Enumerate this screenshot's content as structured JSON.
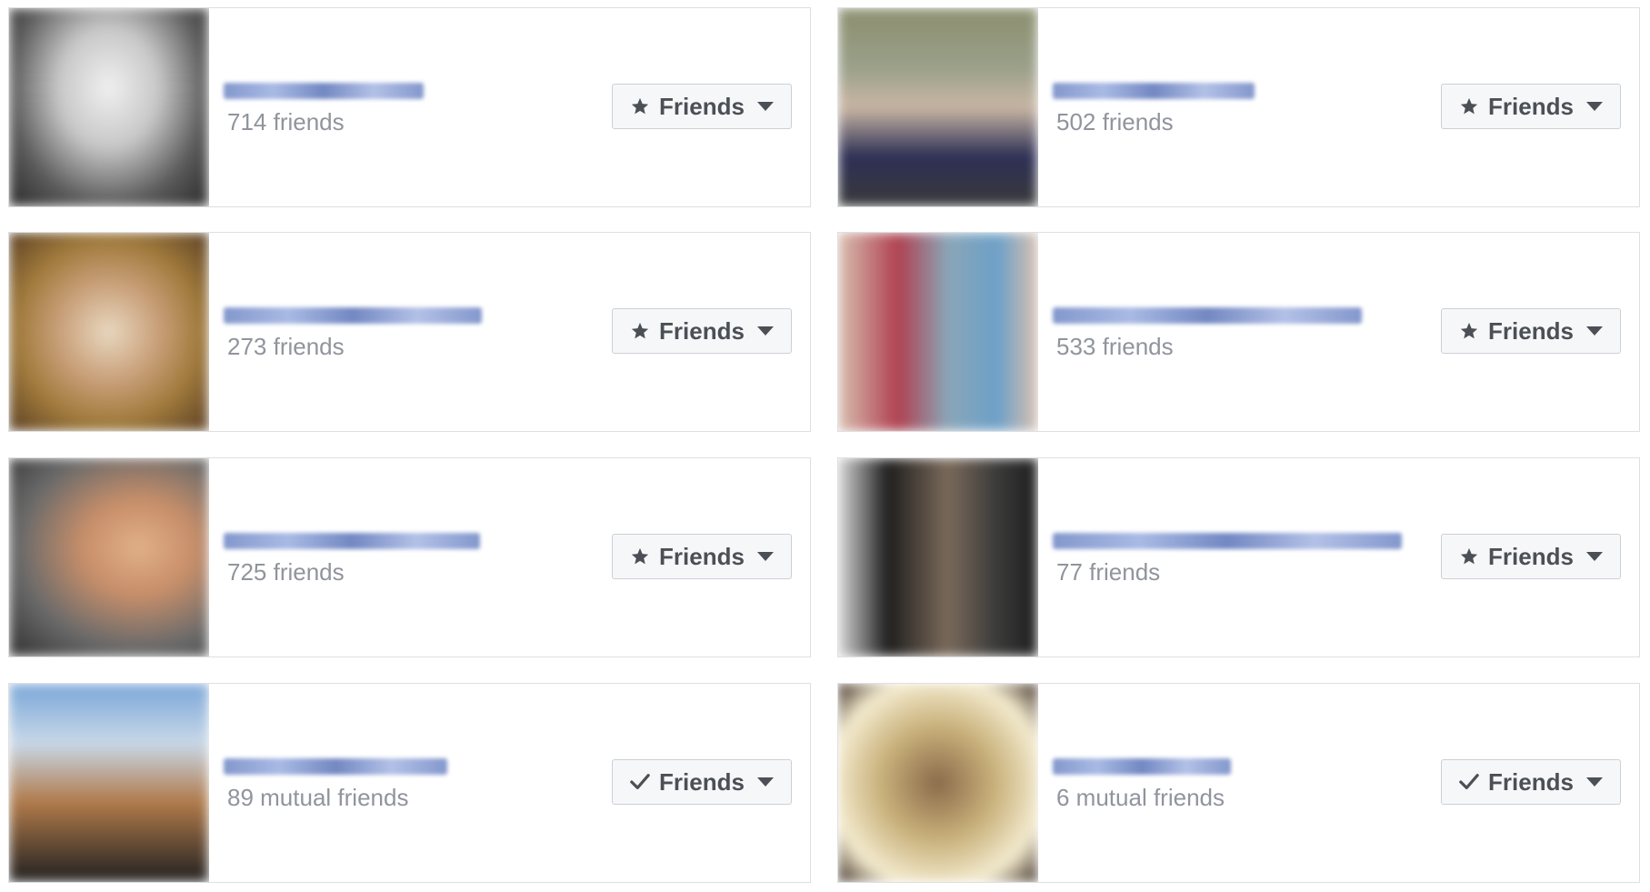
{
  "cards": [
    {
      "count_text": "714 friends",
      "button_label": "Friends",
      "button_icon": "star-icon",
      "photo_colors": [
        "#d9d9d9",
        "#5a5a5a",
        "#f0f0f0",
        "#2a2a2a"
      ]
    },
    {
      "count_text": "502 friends",
      "button_label": "Friends",
      "button_icon": "star-icon",
      "photo_colors": [
        "#8c8f6e",
        "#2d2f55",
        "#c9b7a4",
        "#3a3a3a"
      ]
    },
    {
      "count_text": "273 friends",
      "button_label": "Friends",
      "button_icon": "star-icon",
      "photo_colors": [
        "#a07a3c",
        "#c9a07a",
        "#5a3e22",
        "#e8d8c0"
      ]
    },
    {
      "count_text": "533 friends",
      "button_label": "Friends",
      "button_icon": "star-icon",
      "photo_colors": [
        "#8aa6b8",
        "#b04050",
        "#6ca0c8",
        "#d8c0b0"
      ]
    },
    {
      "count_text": "725 friends",
      "button_label": "Friends",
      "button_icon": "star-icon",
      "photo_colors": [
        "#303030",
        "#c88f6a",
        "#6a6a6a",
        "#e0b088"
      ]
    },
    {
      "count_text": "77 friends",
      "button_label": "Friends",
      "button_icon": "star-icon",
      "photo_colors": [
        "#1e1e1e",
        "#7a6a5a",
        "#d8d8d8",
        "#3a3a3a"
      ]
    },
    {
      "count_text": "89 mutual friends",
      "button_label": "Friends",
      "button_icon": "check-icon",
      "photo_colors": [
        "#7aa6d8",
        "#b07a4a",
        "#202020",
        "#c8d8e8"
      ]
    },
    {
      "count_text": "6 mutual friends",
      "button_label": "Friends",
      "button_icon": "check-icon",
      "photo_colors": [
        "#f4ecd0",
        "#8a6a4a",
        "#c8b07a",
        "#3a2a20"
      ]
    }
  ],
  "colors": {
    "button_text": "#4b4f56",
    "count_text": "#90949c",
    "card_border": "#dddfe2",
    "button_bg": "#f6f7f9",
    "name_blur": "#6e86c4"
  }
}
